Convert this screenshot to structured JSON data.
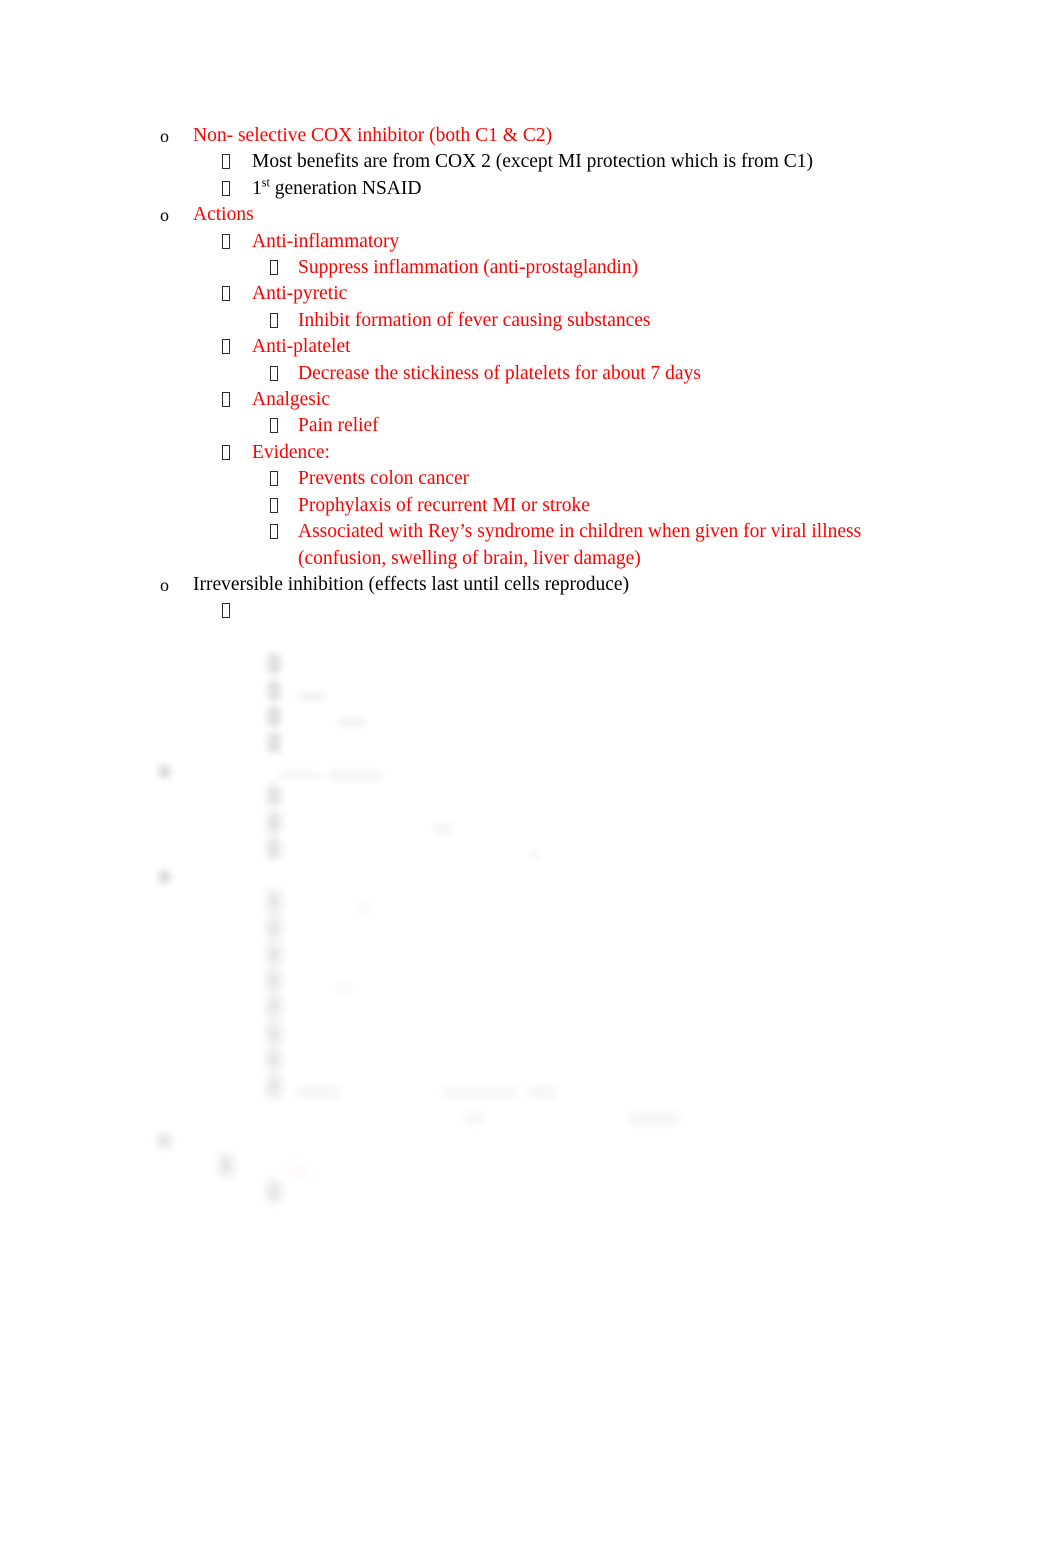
{
  "document": {
    "page_background": "#ffffff",
    "text_color_primary": "#000000",
    "text_color_accent": "#FF0000",
    "bullet_marker_level1": "o",
    "bullet_marker_level2": "missing-glyph-box",
    "bullet_marker_level3": "missing-glyph-box"
  },
  "outline": [
    {
      "id": "l1-cox",
      "level": 1,
      "marker": "o",
      "color": "#FF0000",
      "text": "Non- selective COX inhibitor (both C1 & C2)",
      "legible": true
    },
    {
      "id": "l2-most-benefits",
      "level": 2,
      "marker": "box",
      "color": "#000000",
      "text": "Most benefits are from COX 2 (except MI protection which is from C1)",
      "legible": true
    },
    {
      "id": "l2-first-gen",
      "level": 2,
      "marker": "box",
      "color": "#000000",
      "text_prefix": "1",
      "text_superscript": "st",
      "text_suffix": " generation NSAID",
      "legible": true
    },
    {
      "id": "l1-actions",
      "level": 1,
      "marker": "o",
      "color": "#FF0000",
      "text": "Actions",
      "legible": true
    },
    {
      "id": "l2-anti-inflammatory",
      "level": 2,
      "marker": "box",
      "color": "#FF0000",
      "text": "Anti-inflammatory",
      "legible": true
    },
    {
      "id": "l3-suppress-inflammation",
      "level": 3,
      "marker": "box",
      "color": "#FF0000",
      "text": "Suppress inflammation (anti-prostaglandin)",
      "legible": true
    },
    {
      "id": "l2-anti-pyretic",
      "level": 2,
      "marker": "box",
      "color": "#FF0000",
      "text": "Anti-pyretic",
      "legible": true
    },
    {
      "id": "l3-inhibit-fever",
      "level": 3,
      "marker": "box",
      "color": "#FF0000",
      "text": "Inhibit formation of fever causing substances",
      "legible": true
    },
    {
      "id": "l2-anti-platelet",
      "level": 2,
      "marker": "box",
      "color": "#FF0000",
      "text": "Anti-platelet",
      "legible": true
    },
    {
      "id": "l3-decrease-stickiness",
      "level": 3,
      "marker": "box",
      "color": "#FF0000",
      "text": "Decrease the stickiness of platelets for about 7 days",
      "legible": true
    },
    {
      "id": "l2-analgesic",
      "level": 2,
      "marker": "box",
      "color": "#FF0000",
      "text": "Analgesic",
      "legible": true
    },
    {
      "id": "l3-pain-relief",
      "level": 3,
      "marker": "box",
      "color": "#FF0000",
      "text": "Pain relief",
      "legible": true
    },
    {
      "id": "l2-evidence",
      "level": 2,
      "marker": "box",
      "color": "#FF0000",
      "text": "Evidence:",
      "legible": true
    },
    {
      "id": "l3-prevents-colon-cancer",
      "level": 3,
      "marker": "box",
      "color": "#FF0000",
      "text": "Prevents colon cancer",
      "legible": true
    },
    {
      "id": "l3-prophylaxis-mi-stroke",
      "level": 3,
      "marker": "box",
      "color": "#FF0000",
      "text": "Prophylaxis of recurrent MI or stroke",
      "legible": true
    },
    {
      "id": "l3-reyes-syndrome",
      "level": 3,
      "marker": "box",
      "color": "#FF0000",
      "text": "Associated with Rey’s syndrome in children when given for viral illness (confusion, swelling of brain, liver damage)",
      "legible": true
    },
    {
      "id": "l1-irreversible-inhibition",
      "level": 1,
      "marker": "o",
      "color": "#000000",
      "text": "Irreversible inhibition (effects last until cells reproduce)",
      "legible": true
    }
  ],
  "obscured_region": {
    "note": "Lower portion of the page is blurred in the screenshot; text is not legible.",
    "rows": [
      {
        "id": "ob-1",
        "level": 2,
        "color": "#3a3a3a",
        "blur": "soft",
        "marker_crisp": true,
        "widths": [
          700,
          60
        ]
      },
      {
        "id": "ob-2",
        "level": 3,
        "color": "#3a3a3a",
        "blur": "mid",
        "marker_crisp": false,
        "widths": [
          278
        ]
      },
      {
        "id": "ob-3",
        "level": 3,
        "color": "#3a3a3a",
        "blur": "mid",
        "marker_crisp": false,
        "widths": [
          190
        ]
      },
      {
        "id": "ob-4",
        "level": 3,
        "color": "#3a3a3a",
        "blur": "mid",
        "marker_crisp": false,
        "widths": [
          128
        ]
      },
      {
        "id": "ob-5",
        "level": 3,
        "color": "#3a3a3a",
        "blur": "mid",
        "marker_crisp": false,
        "widths": [
          228
        ]
      },
      {
        "id": "ob-6",
        "level": 1,
        "color": "#3a3a3a",
        "blur": "strong",
        "marker_crisp": false,
        "widths": [
          330
        ]
      },
      {
        "id": "ob-7",
        "level": 3,
        "color": "#3a3a3a",
        "blur": "strong",
        "marker_crisp": false,
        "widths": [
          340
        ]
      },
      {
        "id": "ob-8",
        "level": 3,
        "color": "#3a3a3a",
        "blur": "strong",
        "marker_crisp": false,
        "widths": [
          153
        ]
      },
      {
        "id": "ob-9",
        "level": 3,
        "color": "#3a3a3a",
        "blur": "strong",
        "marker_crisp": false,
        "widths": [
          240
        ]
      },
      {
        "id": "ob-10",
        "level": 1,
        "color": "#3a3a3a",
        "blur": "strong",
        "marker_crisp": false,
        "widths": [
          215
        ]
      },
      {
        "id": "ob-11",
        "level": 3,
        "color": "#3a3a3a",
        "blur": "heavy",
        "marker_crisp": false,
        "widths": [
          70
        ]
      },
      {
        "id": "ob-12",
        "level": 3,
        "color": "#3a3a3a",
        "blur": "heavy",
        "marker_crisp": false,
        "widths": [
          100
        ]
      },
      {
        "id": "ob-13",
        "level": 3,
        "color": "#3a3a3a",
        "blur": "heavy",
        "marker_crisp": false,
        "widths": [
          80
        ]
      },
      {
        "id": "ob-14",
        "level": 3,
        "color": "#3a3a3a",
        "blur": "heavy",
        "marker_crisp": false,
        "widths": [
          50
        ]
      },
      {
        "id": "ob-15",
        "level": 3,
        "color": "#3a3a3a",
        "blur": "heavy",
        "marker_crisp": false,
        "widths": [
          148
        ]
      },
      {
        "id": "ob-16",
        "level": 3,
        "color": "#3a3a3a",
        "blur": "heavy",
        "marker_crisp": false,
        "widths": [
          130
        ]
      },
      {
        "id": "ob-17",
        "level": 3,
        "color": "#3a3a3a",
        "blur": "heavy",
        "marker_crisp": false,
        "widths": [
          163
        ]
      },
      {
        "id": "ob-18",
        "level": 3,
        "color": "#3a3a3a",
        "blur": "heavy",
        "marker_crisp": false,
        "widths": [
          556,
          405
        ]
      },
      {
        "id": "ob-19",
        "level": 1,
        "color": "#FF6B6B",
        "blur": "heavy",
        "marker_crisp": false,
        "widths": [
          152
        ]
      },
      {
        "id": "ob-20",
        "level": 2,
        "color": "#FF6B6B",
        "blur": "heavy",
        "marker_crisp": false,
        "widths": [
          72
        ]
      },
      {
        "id": "ob-21",
        "level": 3,
        "color": "#FF6B6B",
        "blur": "heavy",
        "marker_crisp": false,
        "widths": [
          148
        ]
      }
    ]
  }
}
